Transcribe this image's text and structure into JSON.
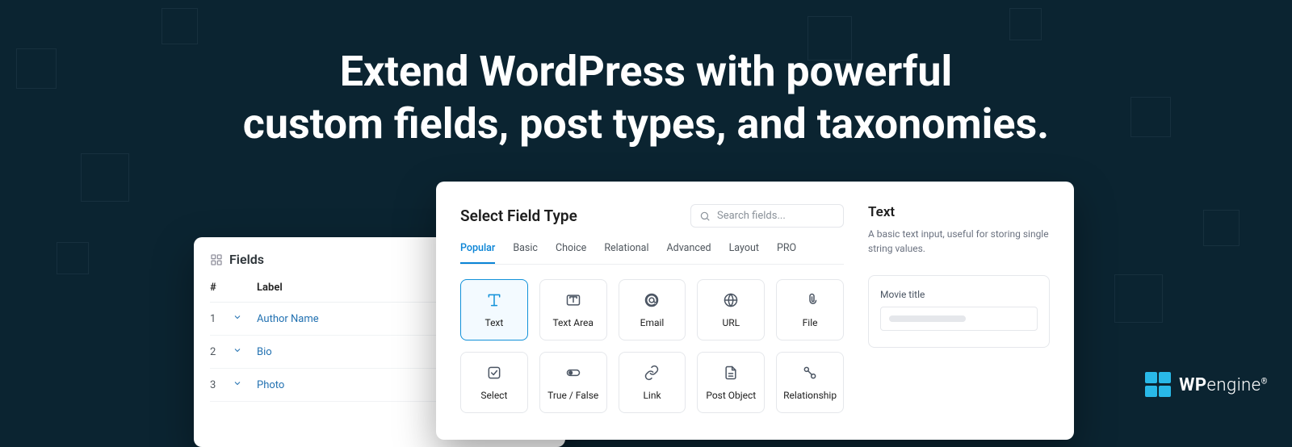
{
  "headline_line1": "Extend WordPress with powerful",
  "headline_line2": "custom fields, post types, and taxonomies.",
  "logo": {
    "brand_bold": "WP",
    "brand_light": "engine"
  },
  "fields_panel": {
    "title": "Fields",
    "col_num": "#",
    "col_label": "Label",
    "rows": [
      {
        "n": "1",
        "label": "Author Name"
      },
      {
        "n": "2",
        "label": "Bio"
      },
      {
        "n": "3",
        "label": "Photo"
      }
    ]
  },
  "select_panel": {
    "title": "Select Field Type",
    "search_placeholder": "Search fields...",
    "tabs": [
      "Popular",
      "Basic",
      "Choice",
      "Relational",
      "Advanced",
      "Layout",
      "PRO"
    ],
    "active_tab": 0,
    "types_row1": [
      {
        "name": "Text",
        "icon": "text",
        "active": true
      },
      {
        "name": "Text Area",
        "icon": "textarea"
      },
      {
        "name": "Email",
        "icon": "email"
      },
      {
        "name": "URL",
        "icon": "url"
      },
      {
        "name": "File",
        "icon": "file"
      }
    ],
    "types_row2": [
      {
        "name": "Select",
        "icon": "select"
      },
      {
        "name": "True / False",
        "icon": "toggle"
      },
      {
        "name": "Link",
        "icon": "link"
      },
      {
        "name": "Post Object",
        "icon": "post"
      },
      {
        "name": "Relationship",
        "icon": "relationship"
      }
    ],
    "sidebar": {
      "title": "Text",
      "desc": "A basic text input, useful for storing single string values.",
      "preview_label": "Movie title"
    }
  }
}
